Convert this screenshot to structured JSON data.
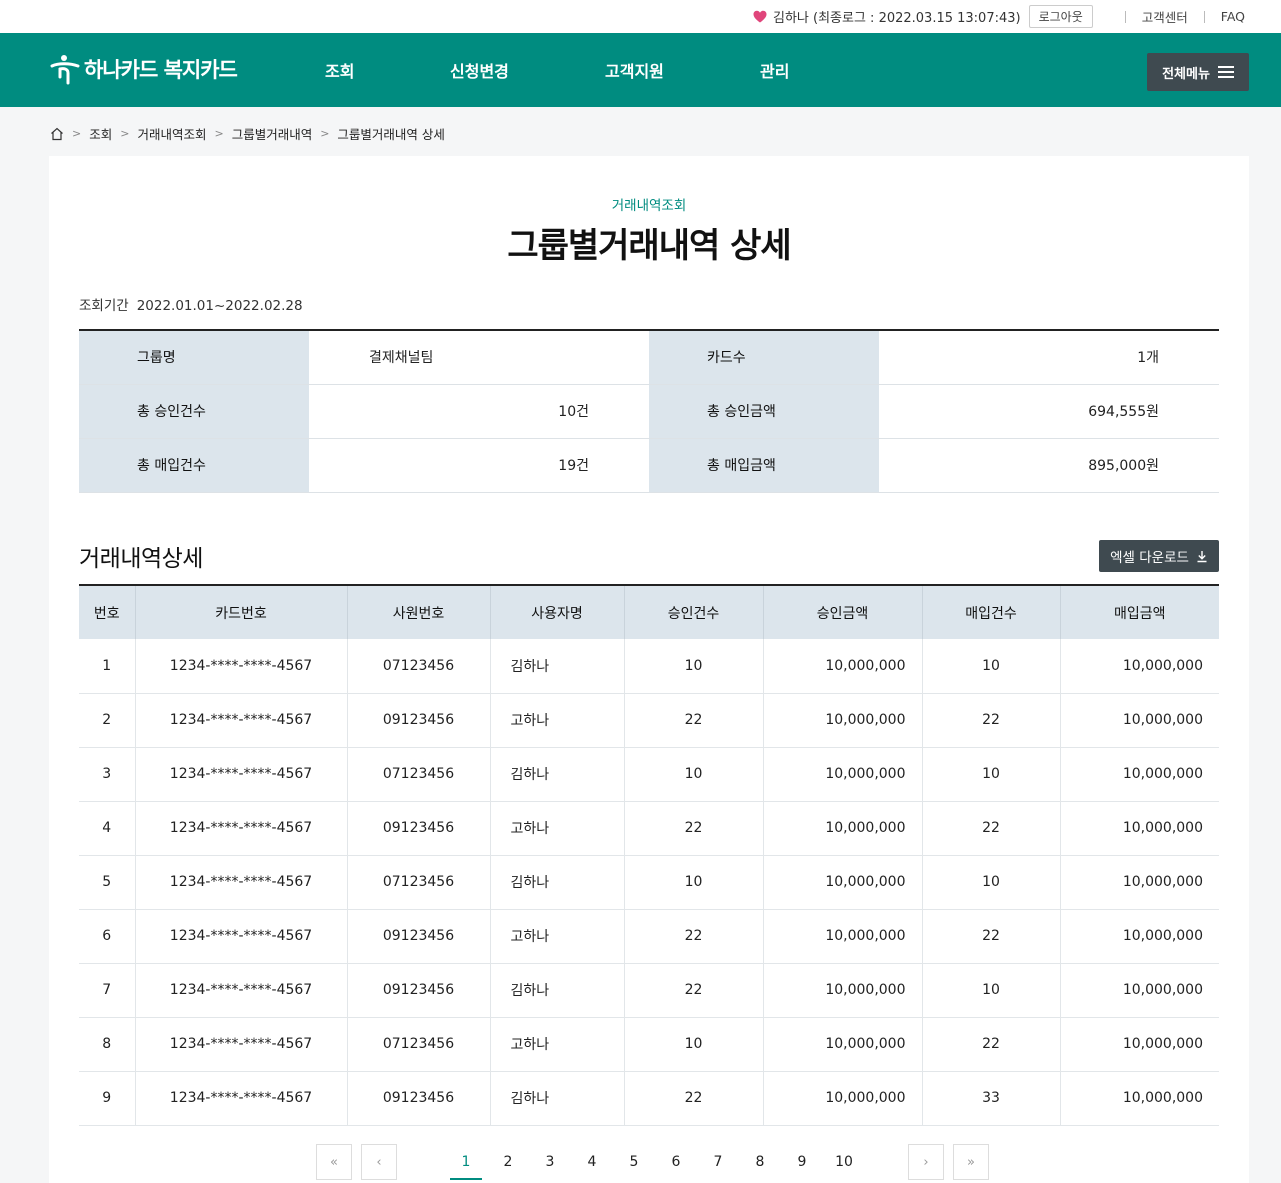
{
  "util": {
    "user": "김하나 (최종로그 : 2022.03.15 13:07:43)",
    "logout": "로그아웃",
    "support": "고객센터",
    "faq": "FAQ"
  },
  "gnb": {
    "logo": "하나카드 복지카드",
    "menu": [
      "조회",
      "신청변경",
      "고객지원",
      "관리"
    ],
    "all_menu": "전체메뉴"
  },
  "breadcrumb": [
    "조회",
    "거래내역조회",
    "그룹별거래내역",
    "그룹별거래내역 상세"
  ],
  "page": {
    "category": "거래내역조회",
    "title": "그룹별거래내역 상세",
    "period_label": "조회기간",
    "period_value": "2022.01.01~2022.02.28"
  },
  "summary": {
    "group_label": "그룹명",
    "group_value": "결제채널팀",
    "cards_label": "카드수",
    "cards_value": "1개",
    "approve_cnt_label": "총 승인건수",
    "approve_cnt_value": "10건",
    "approve_amt_label": "총 승인금액",
    "approve_amt_value": "694,555원",
    "purchase_cnt_label": "총 매입건수",
    "purchase_cnt_value": "19건",
    "purchase_amt_label": "총 매입금액",
    "purchase_amt_value": "895,000원"
  },
  "detail": {
    "title": "거래내역상세",
    "excel": "엑셀 다운로드",
    "columns": [
      "번호",
      "카드번호",
      "사원번호",
      "사용자명",
      "승인건수",
      "승인금액",
      "매입건수",
      "매입금액"
    ],
    "rows": [
      [
        "1",
        "1234-****-****-4567",
        "07123456",
        "김하나",
        "10",
        "10,000,000",
        "10",
        "10,000,000"
      ],
      [
        "2",
        "1234-****-****-4567",
        "09123456",
        "고하나",
        "22",
        "10,000,000",
        "22",
        "10,000,000"
      ],
      [
        "3",
        "1234-****-****-4567",
        "07123456",
        "김하나",
        "10",
        "10,000,000",
        "10",
        "10,000,000"
      ],
      [
        "4",
        "1234-****-****-4567",
        "09123456",
        "고하나",
        "22",
        "10,000,000",
        "22",
        "10,000,000"
      ],
      [
        "5",
        "1234-****-****-4567",
        "07123456",
        "김하나",
        "10",
        "10,000,000",
        "10",
        "10,000,000"
      ],
      [
        "6",
        "1234-****-****-4567",
        "09123456",
        "고하나",
        "22",
        "10,000,000",
        "22",
        "10,000,000"
      ],
      [
        "7",
        "1234-****-****-4567",
        "09123456",
        "김하나",
        "22",
        "10,000,000",
        "10",
        "10,000,000"
      ],
      [
        "8",
        "1234-****-****-4567",
        "07123456",
        "고하나",
        "10",
        "10,000,000",
        "22",
        "10,000,000"
      ],
      [
        "9",
        "1234-****-****-4567",
        "09123456",
        "김하나",
        "22",
        "10,000,000",
        "33",
        "10,000,000"
      ]
    ]
  },
  "pagination": {
    "first": "«",
    "prev": "‹",
    "next": "›",
    "last": "»",
    "pages": [
      "1",
      "2",
      "3",
      "4",
      "5",
      "6",
      "7",
      "8",
      "9",
      "10"
    ],
    "current": "1"
  },
  "colors": {
    "brand": "#008c80",
    "header_cell": "#dce5ec",
    "link": "#1a3fd6",
    "dark_button": "#3f4a50",
    "heart": "#e0457b"
  }
}
